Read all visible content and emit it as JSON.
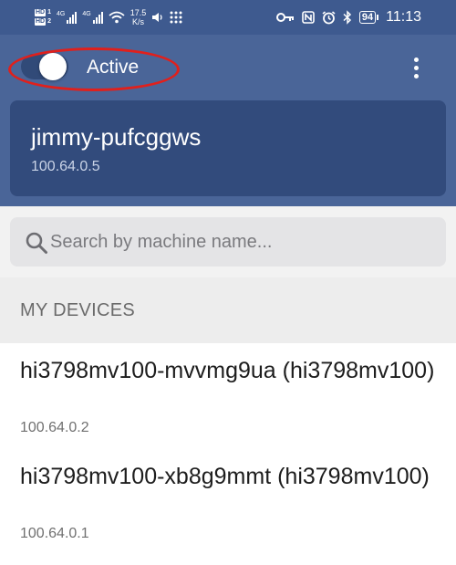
{
  "status_bar": {
    "sim1_label": "HD",
    "sim1_num": "1",
    "sim2_label": "HD",
    "sim2_num": "2",
    "net1": "4G",
    "net2": "4G",
    "speed_value": "17.5",
    "speed_unit": "K/s",
    "battery": "94",
    "time": "11:13"
  },
  "header": {
    "toggle_state": "on",
    "toggle_label": "Active"
  },
  "self_device": {
    "name": "jimmy-pufcggws",
    "ip": "100.64.0.5"
  },
  "search": {
    "placeholder": "Search by machine name..."
  },
  "section": {
    "title": "MY DEVICES"
  },
  "devices": [
    {
      "name": "hi3798mv100-mvvmg9ua (hi3798mv100)",
      "ip": "100.64.0.2"
    },
    {
      "name": "hi3798mv100-xb8g9mmt (hi3798mv100)",
      "ip": "100.64.0.1"
    }
  ],
  "colors": {
    "header": "#4a6598",
    "card": "#324b7c",
    "highlight": "#e0201c"
  }
}
